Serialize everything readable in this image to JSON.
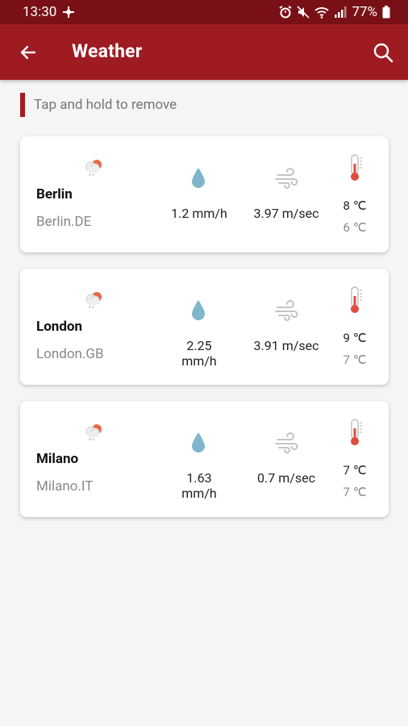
{
  "status_bar": {
    "time": "13:30",
    "battery": "77%"
  },
  "app_bar": {
    "title": "Weather"
  },
  "hint": "Tap and hold to remove",
  "cities": [
    {
      "name": "Berlin",
      "code": "Berlin.DE",
      "rain": "1.2 mm/h",
      "wind": "3.97 m/sec",
      "temp_max": "8 ℃",
      "temp_min": "6 ℃"
    },
    {
      "name": "London",
      "code": "London.GB",
      "rain": "2.25 mm/h",
      "wind": "3.91 m/sec",
      "temp_max": "9 ℃",
      "temp_min": "7 ℃"
    },
    {
      "name": "Milano",
      "code": "Milano.IT",
      "rain": "1.63 mm/h",
      "wind": "0.7 m/sec",
      "temp_max": "7 ℃",
      "temp_min": "7 ℃"
    }
  ],
  "colors": {
    "status_bar": "#7a1017",
    "app_bar": "#9e1b22",
    "accent": "#a31c24",
    "drop": "#7fb6cc",
    "thermo": "#e04c3c"
  }
}
